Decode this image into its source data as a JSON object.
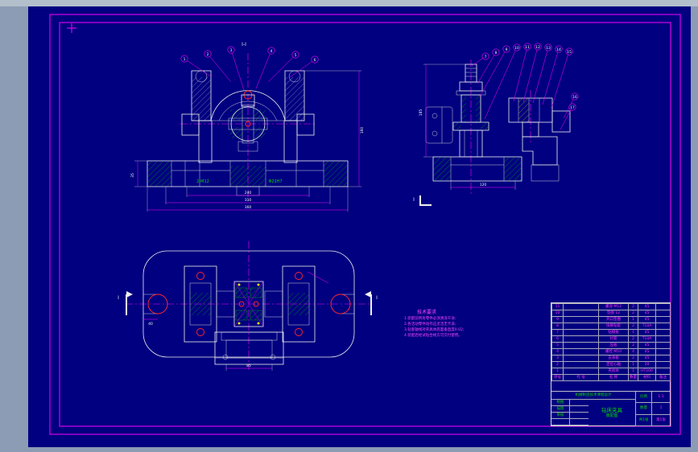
{
  "palette": {
    "canvas_bg": "#000080",
    "desktop_bg": "#8c9cb5",
    "frame_color": "#ff00ff",
    "line_white": "#f0f0f0",
    "hatch_green": "#00b400",
    "hatch_yellow": "#c8c800",
    "accent_red": "#ff2828",
    "text_magenta": "#ff35ff",
    "text_green": "#00dc00"
  },
  "front_view": {
    "section_label": "I-I",
    "balloons": [
      "1",
      "2",
      "3",
      "4",
      "5",
      "6"
    ],
    "green_labels": [
      "2-M12",
      "Φ22H7"
    ],
    "dims": {
      "w1": "240",
      "w2": "310",
      "w3": "360",
      "h": "160",
      "t": "35"
    }
  },
  "side_view": {
    "balloons": [
      "7",
      "8",
      "9",
      "10",
      "11",
      "12",
      "13",
      "14",
      "15",
      "16",
      "17"
    ],
    "dims": {
      "h": "185",
      "w": "120"
    },
    "section_mark": "I"
  },
  "plan_view": {
    "section_mark_left": "I",
    "section_mark_right": "I",
    "dims": {
      "slot": "40"
    }
  },
  "detail_view": {
    "dims": {
      "w": "85"
    }
  },
  "tech": {
    "title": "技术要求",
    "lines": [
      "1.装配前所有零件必须清洗干净;",
      "2.各活动零件动作应灵活无卡滞;",
      "3.钻套轴线对夹具体底面垂直度0.02;",
      "4.装配后经试钻合格方可交付使用。"
    ]
  },
  "title_block": {
    "bom": {
      "headers": [
        "序号",
        "代 号",
        "名 称",
        "数量",
        "材料",
        "备注"
      ],
      "rows": [
        [
          "11",
          "",
          "螺母 M12",
          "2",
          "45",
          ""
        ],
        [
          "10",
          "",
          "垫圈 12",
          "2",
          "45",
          ""
        ],
        [
          "9",
          "",
          "开口垫圈",
          "1",
          "45",
          ""
        ],
        [
          "8",
          "",
          "快换钻套",
          "2",
          "T10A",
          ""
        ],
        [
          "7",
          "",
          "钻模板",
          "1",
          "45",
          ""
        ],
        [
          "6",
          "",
          "衬套",
          "2",
          "T10A",
          ""
        ],
        [
          "5",
          "",
          "压板",
          "2",
          "45",
          ""
        ],
        [
          "4",
          "",
          "螺栓 M10",
          "4",
          "45",
          ""
        ],
        [
          "3",
          "",
          "支承板",
          "2",
          "45",
          ""
        ],
        [
          "2",
          "",
          "定位心轴",
          "1",
          "20",
          ""
        ],
        [
          "1",
          "",
          "夹具体",
          "1",
          "HT200",
          ""
        ]
      ]
    },
    "school": "机械制造技术课程设计",
    "title": "钻床夹具",
    "subtitle": "装配图",
    "left_rows": [
      {
        "label": "制图",
        "value": ""
      },
      {
        "label": "描图",
        "value": ""
      },
      {
        "label": "审核",
        "value": ""
      },
      {
        "label": "",
        "value": ""
      }
    ],
    "right_rows": [
      {
        "label": "比例",
        "value": "1:1"
      },
      {
        "label": "数量",
        "value": "1"
      },
      {
        "label": "共1张",
        "value": "第1张"
      }
    ]
  }
}
